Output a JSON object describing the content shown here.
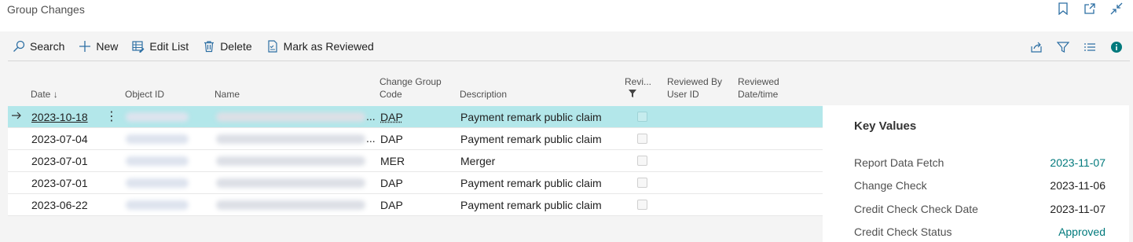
{
  "page": {
    "title": "Group Changes"
  },
  "window_icons": [
    "bookmark-icon",
    "open-new-window-icon",
    "collapse-icon"
  ],
  "actions": {
    "search": "Search",
    "new": "New",
    "edit_list": "Edit List",
    "delete": "Delete",
    "mark_reviewed": "Mark as Reviewed"
  },
  "right_actions": [
    "share-icon",
    "filter-icon",
    "list-view-icon",
    "info-icon"
  ],
  "columns": {
    "date": "Date",
    "object_id": "Object ID",
    "name": "Name",
    "change_group_code_1": "Change Group",
    "change_group_code_2": "Code",
    "description": "Description",
    "reviewed": "Revi...",
    "reviewed_by_1": "Reviewed By",
    "reviewed_by_2": "User ID",
    "reviewed_dt_1": "Reviewed",
    "reviewed_dt_2": "Date/time"
  },
  "rows": [
    {
      "date": "2023-10-18",
      "code": "DAP",
      "description": "Payment remark public claim",
      "ellipsis": "...",
      "reviewed": false
    },
    {
      "date": "2023-07-04",
      "code": "DAP",
      "description": "Payment remark public claim",
      "ellipsis": "...",
      "reviewed": false
    },
    {
      "date": "2023-07-01",
      "code": "MER",
      "description": "Merger",
      "ellipsis": "",
      "reviewed": false
    },
    {
      "date": "2023-07-01",
      "code": "DAP",
      "description": "Payment remark public claim",
      "ellipsis": "",
      "reviewed": false
    },
    {
      "date": "2023-06-22",
      "code": "DAP",
      "description": "Payment remark public claim",
      "ellipsis": "",
      "reviewed": false
    }
  ],
  "factbox": {
    "title": "Key Values",
    "items": [
      {
        "label": "Report Data Fetch",
        "value": "2023-11-07"
      },
      {
        "label": "Change Check",
        "value": "2023-11-06"
      },
      {
        "label": "Credit Check Check Date",
        "value": "2023-11-07"
      },
      {
        "label": "Credit Check Status",
        "value": "Approved"
      }
    ]
  },
  "colors": {
    "accent": "#00797c",
    "selected_row": "#b3e7ea"
  }
}
